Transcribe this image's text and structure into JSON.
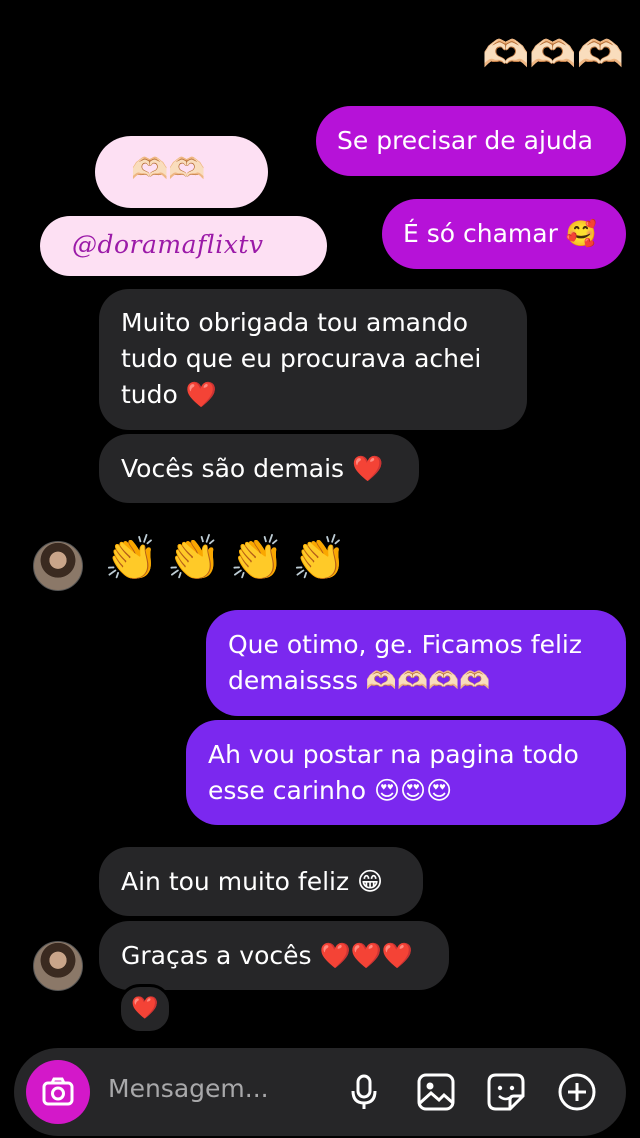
{
  "top_emojis": "🫶🏻🫶🏻🫶🏻",
  "messages": {
    "sent_1": "Se precisar de ajuda",
    "received_hands": "🫶🏻🫶🏻",
    "received_handle": "@doramaflixtv",
    "sent_2": "É só chamar 🥰",
    "recv_1_line1": "Muito obrigada tou amando",
    "recv_1_line2": "tudo que eu procurava achei",
    "recv_1_line3": "tudo ❤️",
    "recv_2": "Vocês são demais ❤️",
    "recv_claps": "👏👏👏👏",
    "sent_3_line1": "Que otimo, ge. Ficamos feliz",
    "sent_3_line2": "demaissss 🫶🏻🫶🏻🫶🏻🫶🏻",
    "sent_4_line1": "Ah vou postar na pagina todo",
    "sent_4_line2": "esse carinho 😍😍😍",
    "recv_3": "Ain tou muito feliz 😁",
    "recv_4": "Graças a vocês ❤️❤️❤️",
    "reaction": "❤️"
  },
  "composer": {
    "placeholder": "Mensagem...",
    "icons": [
      "camera-icon",
      "microphone-icon",
      "image-icon",
      "sticker-icon",
      "plus-icon"
    ]
  },
  "colors": {
    "sent_magenta": "#b612d8",
    "sent_violet": "#7b28ef",
    "received_gray": "#262628",
    "handle_bg": "#fde0f3",
    "camera_button": "#d318c9"
  }
}
